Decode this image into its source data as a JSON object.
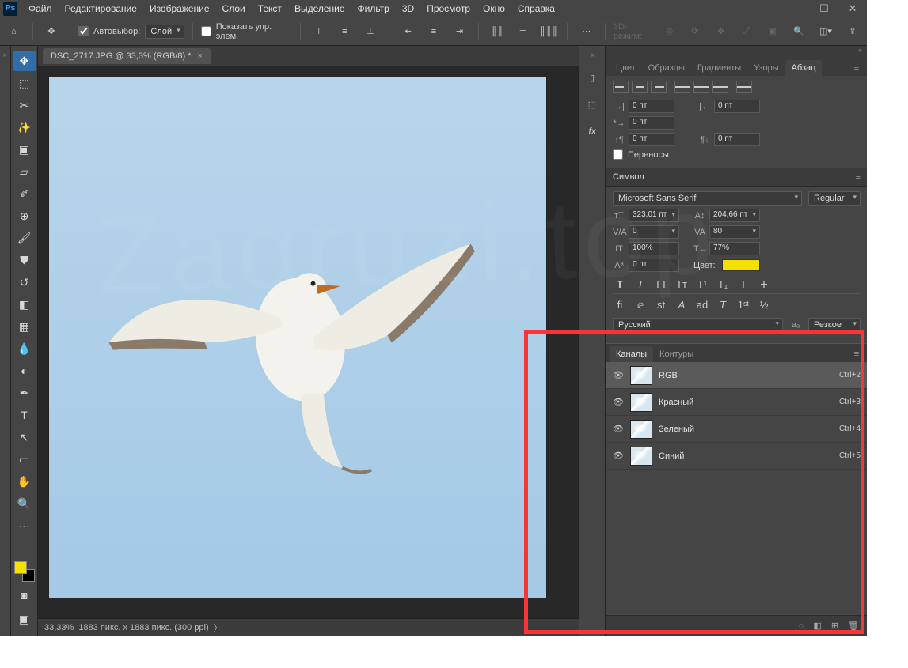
{
  "app_logo": "Ps",
  "menu": [
    "Файл",
    "Редактирование",
    "Изображение",
    "Слои",
    "Текст",
    "Выделение",
    "Фильтр",
    "3D",
    "Просмотр",
    "Окно",
    "Справка"
  ],
  "options": {
    "auto_select_label": "Автовыбор:",
    "auto_select_target": "Слой",
    "show_controls_label": "Показать упр. элем.",
    "mode3d_label": "3D-режим:"
  },
  "document": {
    "tab_title": "DSC_2717.JPG @ 33,3% (RGB/8) *",
    "status_zoom": "33,33%",
    "status_dims": "1883 пикс. x 1883 пикс. (300 ppi)"
  },
  "right_tabs_top": {
    "items": [
      "Цвет",
      "Образцы",
      "Градиенты",
      "Узоры",
      "Абзац"
    ],
    "active": "Абзац"
  },
  "paragraph": {
    "indent_left": "0 пт",
    "indent_right": "0 пт",
    "indent_first": "0 пт",
    "space_before": "0 пт",
    "space_after": "0 пт",
    "hyphenation_label": "Переносы"
  },
  "character": {
    "header": "Символ",
    "font_family": "Microsoft Sans Serif",
    "font_style": "Regular",
    "font_size": "323,01 пт",
    "leading": "204,66 пт",
    "tracking": "0",
    "va": "80",
    "vert_scale": "100%",
    "horiz_scale": "77%",
    "baseline": "0 пт",
    "color_label": "Цвет:",
    "color_value": "#f5e100",
    "language": "Русский",
    "aa": "Резкое"
  },
  "channels_tabs": {
    "items": [
      "Каналы",
      "Контуры"
    ],
    "active": "Каналы"
  },
  "channels": [
    {
      "name": "RGB",
      "shortcut": "Ctrl+2",
      "selected": true
    },
    {
      "name": "Красный",
      "shortcut": "Ctrl+3",
      "selected": false
    },
    {
      "name": "Зеленый",
      "shortcut": "Ctrl+4",
      "selected": false
    },
    {
      "name": "Синий",
      "shortcut": "Ctrl+5",
      "selected": false
    }
  ],
  "tool_icons": [
    "✥",
    "⬚",
    "✧",
    "✎",
    "✂",
    "▱",
    "✐",
    "⊕",
    "⌖",
    "◌",
    "⟋",
    "⟋",
    "◧",
    "△",
    "●",
    "✎",
    "⟋",
    "T",
    "↖",
    "▭",
    "✋",
    "🔍",
    "⋯"
  ],
  "midstrip_icons": [
    "▯",
    "⬚",
    "fx"
  ],
  "align_icons_para": [
    "L",
    "C",
    "R",
    "JL",
    "JC",
    "JR",
    "JF"
  ],
  "chanfooter_icons": [
    "◌",
    "◧",
    "⊞",
    "🗑"
  ]
}
